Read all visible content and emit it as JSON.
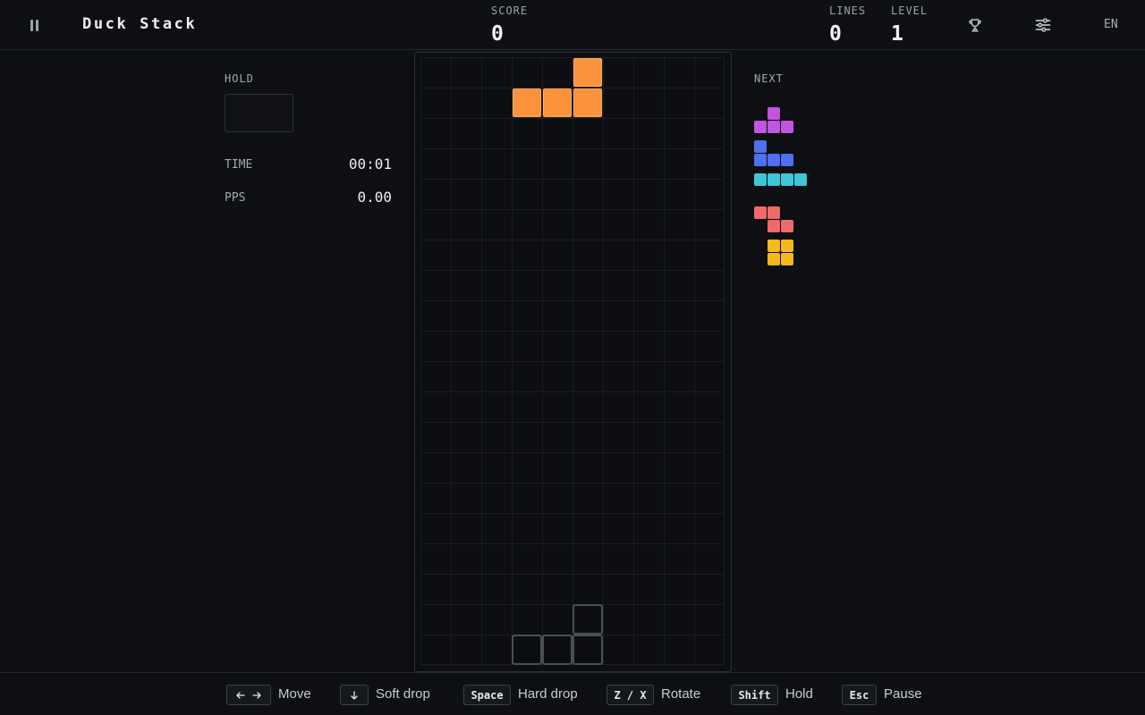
{
  "app": {
    "title": "Duck Stack",
    "language": "EN"
  },
  "stats": {
    "score_label": "SCORE",
    "score": "0",
    "lines_label": "LINES",
    "lines": "0",
    "level_label": "LEVEL",
    "level": "1"
  },
  "icons": {
    "pause": "pause-icon",
    "leaderboard": "trophy-icon",
    "settings": "sliders-icon"
  },
  "left_panel": {
    "hold_label": "HOLD",
    "time_label": "TIME",
    "time": "00:01",
    "pps_label": "PPS",
    "pps": "0.00"
  },
  "board": {
    "columns": 10,
    "rows": 20,
    "active_piece": {
      "type": "L",
      "color": "#fb923c",
      "cells": [
        [
          5,
          0
        ],
        [
          3,
          1
        ],
        [
          4,
          1
        ],
        [
          5,
          1
        ]
      ]
    },
    "ghost_piece": {
      "cells": [
        [
          5,
          18
        ],
        [
          3,
          19
        ],
        [
          4,
          19
        ],
        [
          5,
          19
        ]
      ]
    }
  },
  "next_panel": {
    "label": "NEXT",
    "queue": [
      {
        "type": "T",
        "color": "#c055e0"
      },
      {
        "type": "J",
        "color": "#4f6ef0"
      },
      {
        "type": "I",
        "color": "#3cc6d8"
      },
      {
        "type": "Z",
        "color": "#f06a6a"
      },
      {
        "type": "O",
        "color": "#f5b919"
      }
    ]
  },
  "controls": [
    {
      "keys": "← →",
      "label": "Move"
    },
    {
      "keys": "↓",
      "label": "Soft drop"
    },
    {
      "keys": "Space",
      "label": "Hard drop"
    },
    {
      "keys": "Z / X",
      "label": "Rotate"
    },
    {
      "keys": "Shift",
      "label": "Hold"
    },
    {
      "keys": "Esc",
      "label": "Pause"
    }
  ]
}
